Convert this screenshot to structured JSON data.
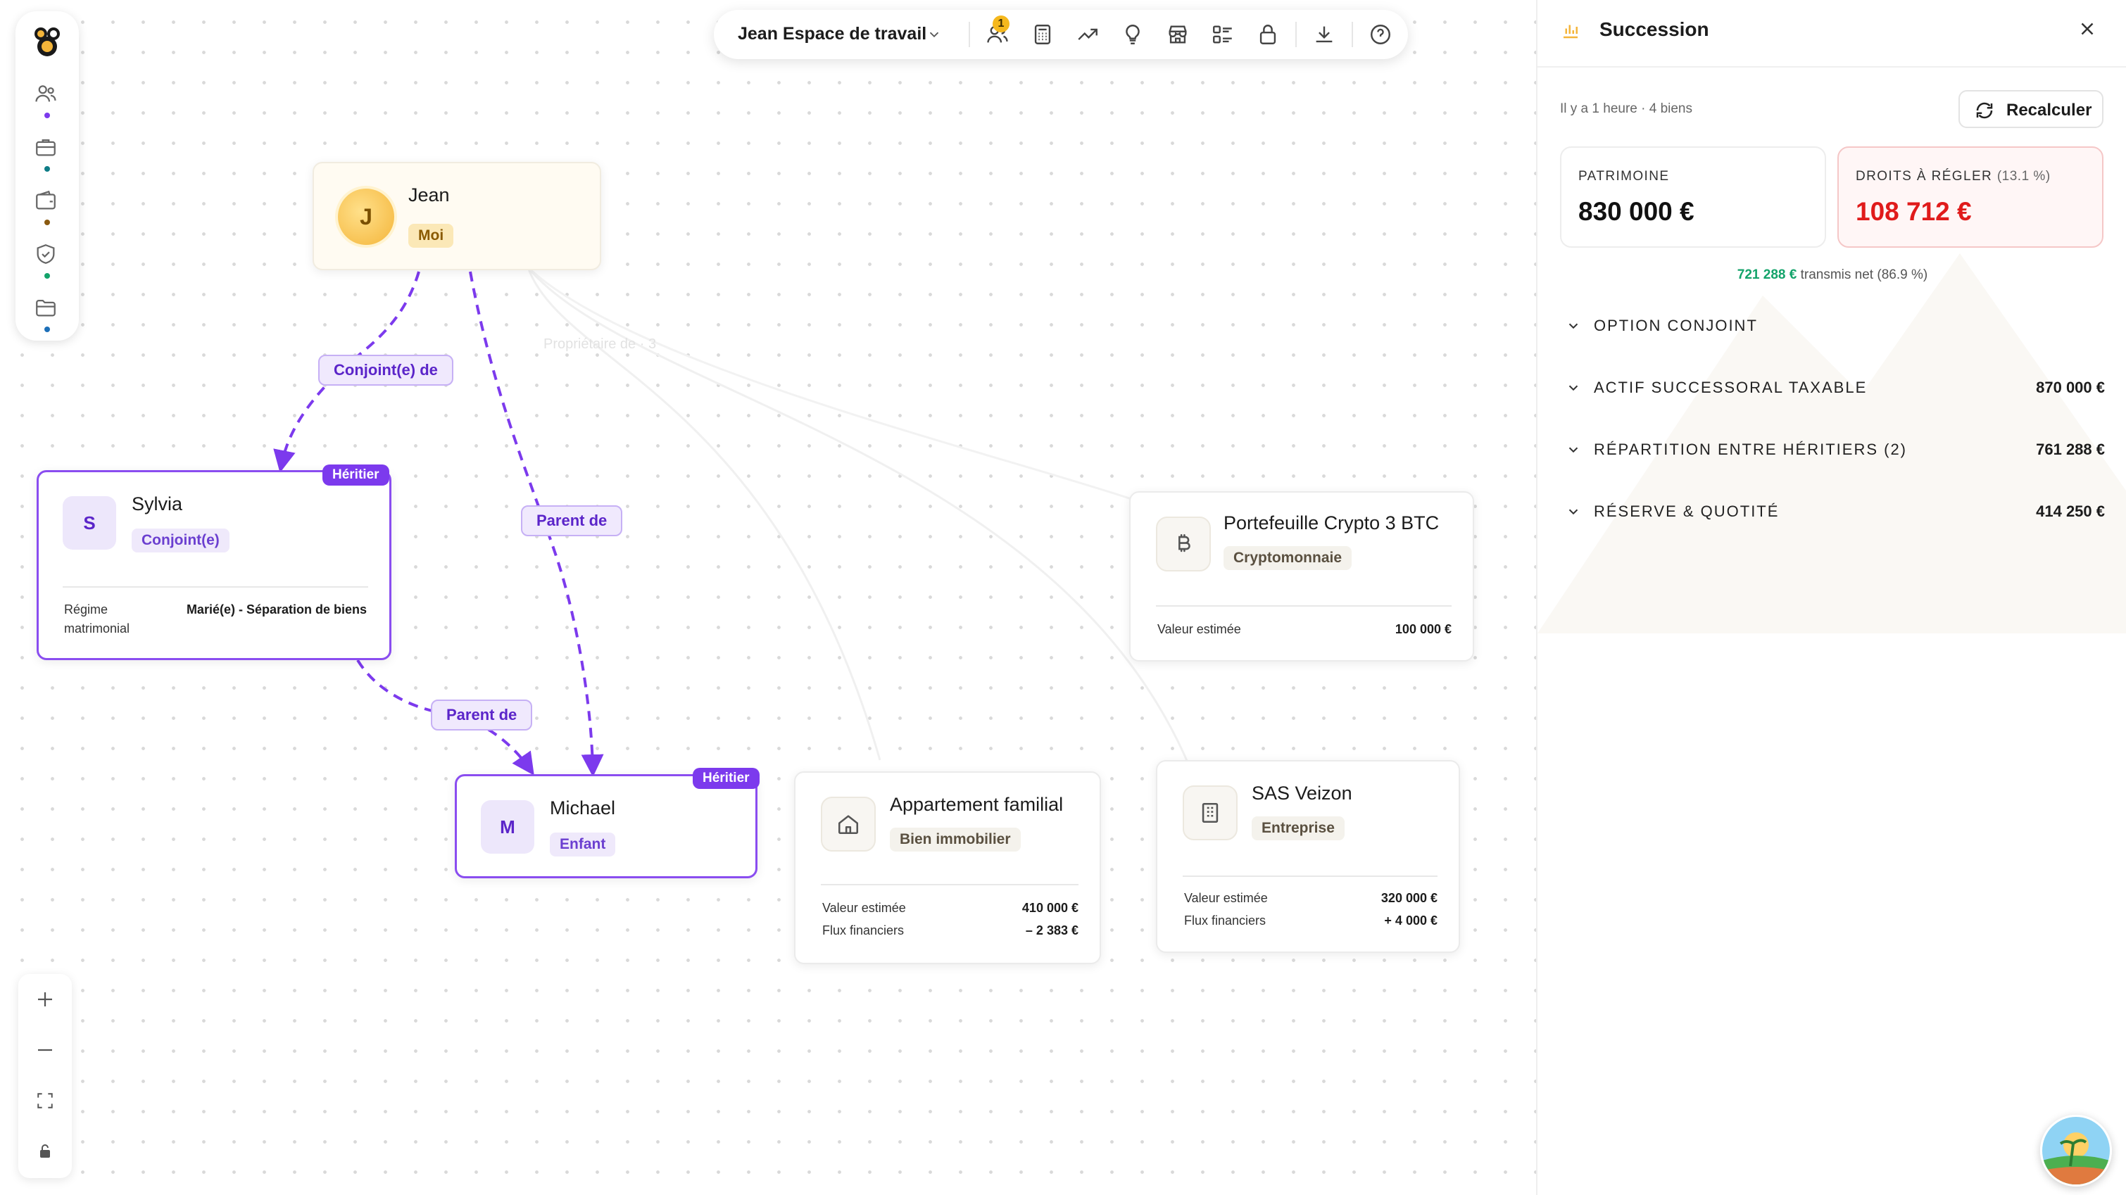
{
  "toolbar": {
    "workspace": "Jean Espace de travail",
    "notification_count": "1",
    "icons": [
      "users-icon",
      "calculator-icon",
      "trend-icon",
      "lightbulb-icon",
      "store-icon",
      "checklist-icon",
      "lock-icon",
      "download-icon",
      "help-icon"
    ]
  },
  "sidebar": {
    "items": [
      {
        "icon": "people-icon",
        "dot": "#7c3aed"
      },
      {
        "icon": "briefcase-icon",
        "dot": "#0e7c86"
      },
      {
        "icon": "wallet-icon",
        "dot": "#8a5a10"
      },
      {
        "icon": "shield-icon",
        "dot": "#13a36a"
      },
      {
        "icon": "folder-icon",
        "dot": "#1d6fb8"
      }
    ]
  },
  "graph": {
    "jean": {
      "initial": "J",
      "name": "Jean",
      "tag": "Moi"
    },
    "sylvia": {
      "initial": "S",
      "name": "Sylvia",
      "tag": "Conjoint(e)",
      "badge": "Héritier",
      "row_label": "Régime matrimonial",
      "row_value": "Marié(e) - Séparation de biens"
    },
    "michael": {
      "initial": "M",
      "name": "Michael",
      "tag": "Enfant",
      "badge": "Héritier"
    },
    "crypto": {
      "name": "Portefeuille Crypto 3 BTC",
      "tag": "Cryptomonnaie",
      "rows": [
        {
          "label": "Valeur estimée",
          "value": "100 000 €"
        }
      ]
    },
    "appart": {
      "name": "Appartement familial",
      "tag": "Bien immobilier",
      "rows": [
        {
          "label": "Valeur estimée",
          "value": "410 000 €"
        },
        {
          "label": "Flux financiers",
          "value": "– 2 383 €"
        }
      ]
    },
    "sas": {
      "name": "SAS Veizon",
      "tag": "Entreprise",
      "rows": [
        {
          "label": "Valeur estimée",
          "value": "320 000 €"
        },
        {
          "label": "Flux financiers",
          "value": "+ 4 000 €"
        }
      ]
    },
    "edges": {
      "conjoint": "Conjoint(e) de",
      "parent1": "Parent de",
      "parent2": "Parent de",
      "proprietaire": "Propriétaire de · 3"
    }
  },
  "panel": {
    "title": "Succession",
    "subtitle": "Il y a 1 heure · 4 biens",
    "recalc_label": "Recalculer",
    "patrimoine_label": "PATRIMOINE",
    "patrimoine_value": "830 000 €",
    "droits_label": "DROITS À RÉGLER",
    "droits_pct": "(13.1 %)",
    "droits_value": "108 712 €",
    "net_value": "721 288 €",
    "net_text": "transmis net (86.9 %)",
    "sections": [
      {
        "label": "OPTION CONJOINT",
        "value": ""
      },
      {
        "label": "ACTIF SUCCESSORAL TAXABLE",
        "value": "870 000 €"
      },
      {
        "label": "RÉPARTITION ENTRE HÉRITIERS (2)",
        "value": "761 288 €"
      },
      {
        "label": "RÉSERVE & QUOTITÉ",
        "value": "414 250 €"
      }
    ],
    "colors": {
      "droits": "#e01b1b",
      "net": "#13a36a",
      "accent": "#7c3aed"
    }
  }
}
